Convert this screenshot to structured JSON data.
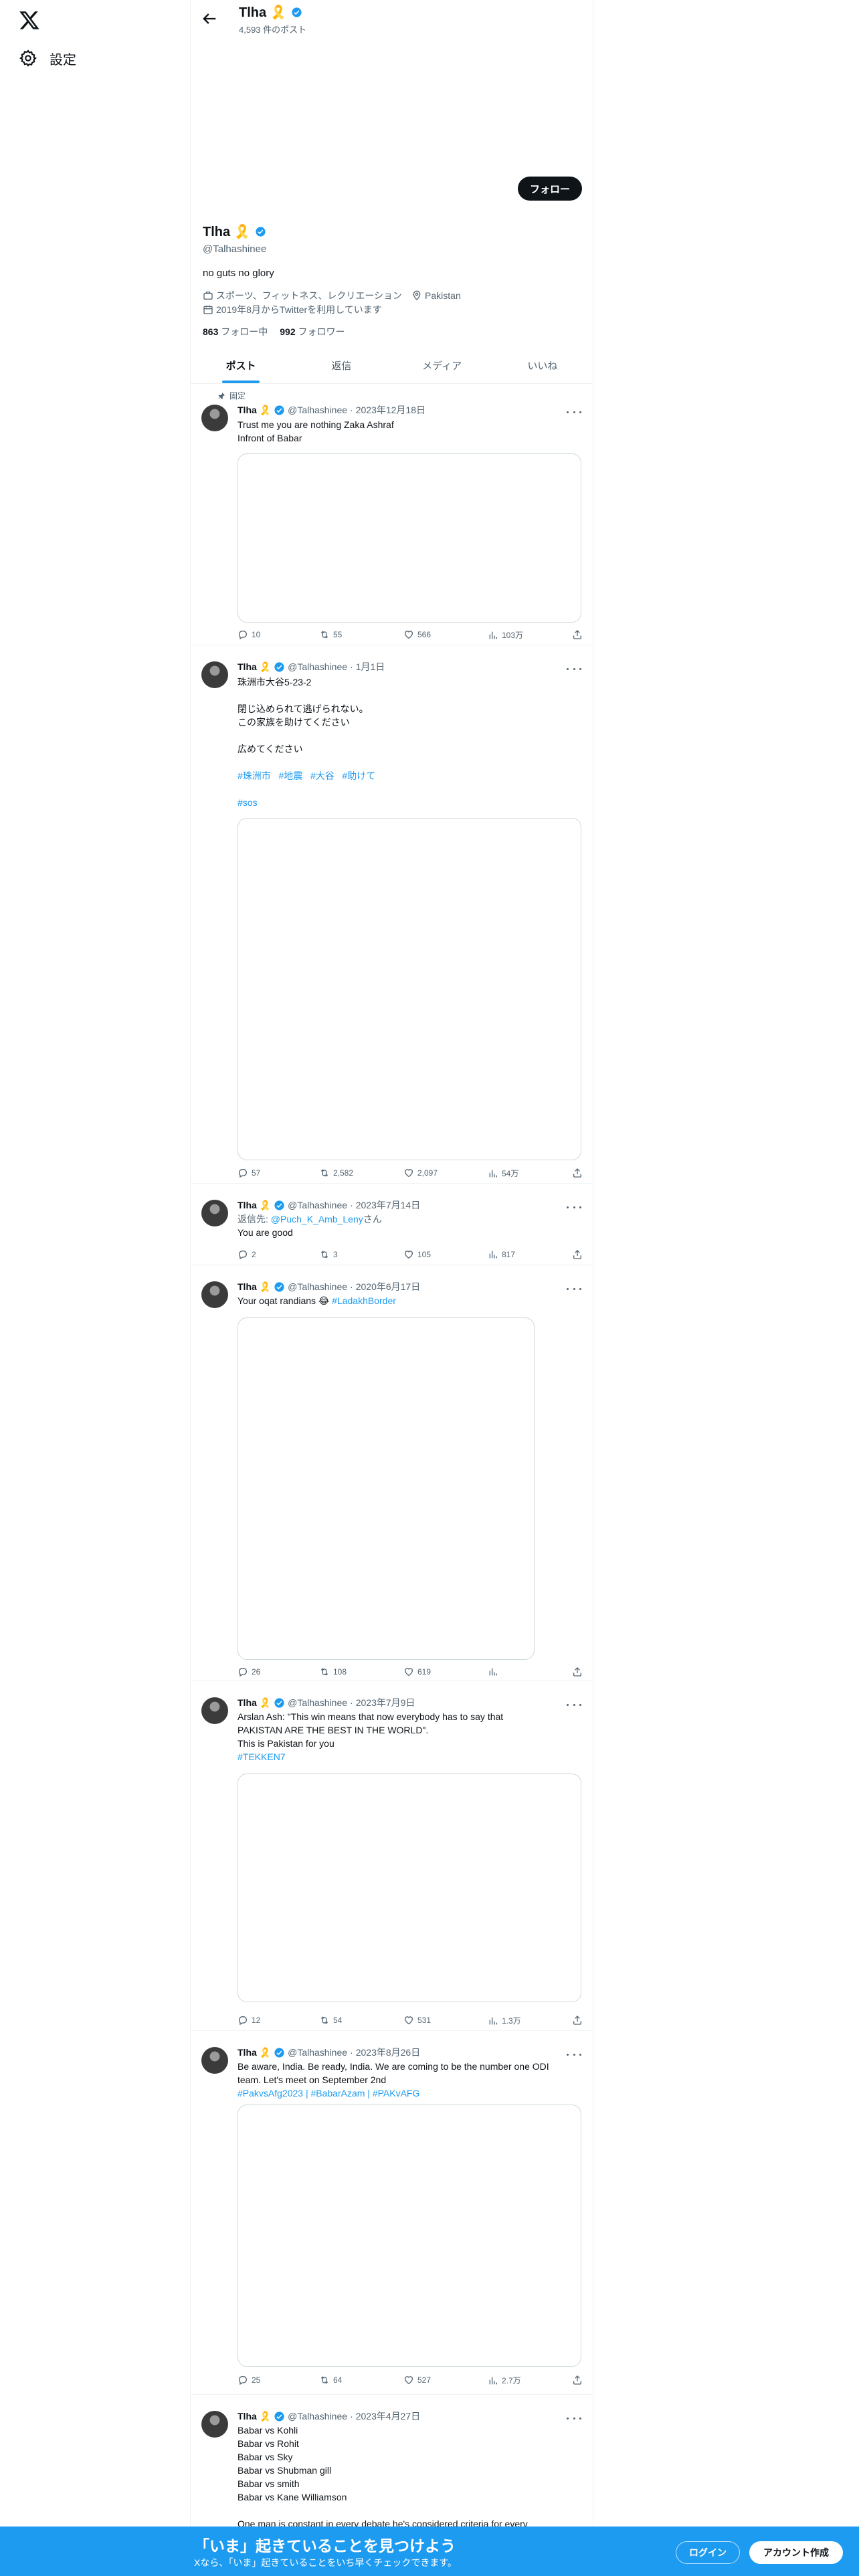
{
  "nav": {
    "settings_label": "設定"
  },
  "header": {
    "name": "Tlha 🎗️",
    "post_count": "4,593 件のポスト"
  },
  "profile": {
    "follow_label": "フォロー",
    "name": "Tlha 🎗️",
    "handle": "@Talhashinee",
    "bio": "no guts no glory",
    "category": "スポーツ、フィットネス、レクリエーション",
    "location": "Pakistan",
    "joined": "2019年8月からTwitterを利用しています",
    "following_count": "863",
    "following_label": "フォロー中",
    "followers_count": "992",
    "followers_label": "フォロワー"
  },
  "tabs": [
    {
      "label": "ポスト",
      "active": true
    },
    {
      "label": "返信"
    },
    {
      "label": "メディア"
    },
    {
      "label": "いいね"
    }
  ],
  "tweets": [
    {
      "pinned": "固定",
      "name": "Tlha 🎗️",
      "handle": "@Talhashinee",
      "date": "2023年12月18日",
      "lines": [
        "Trust me you are nothing Zaka Ashraf",
        "Infront of Babar"
      ],
      "replies": "10",
      "retweets": "55",
      "likes": "566",
      "views": "103万"
    },
    {
      "name": "Tlha 🎗️",
      "handle": "@Talhashinee",
      "date": "1月1日",
      "lines": [
        "珠洲市大谷5-23-2",
        "",
        "閉じ込められて逃げられない。",
        "この家族を助けてください",
        "",
        "広めてください"
      ],
      "hashtags": [
        "#珠洲市",
        "#地震",
        "#大谷",
        "#助けて"
      ],
      "hashtag2": "#sos",
      "replies": "57",
      "retweets": "2,582",
      "likes": "2,097",
      "views": "54万"
    },
    {
      "name": "Tlha 🎗️",
      "handle": "@Talhashinee",
      "date": "2023年7月14日",
      "reply_prefix": "返信先: ",
      "reply_to": "@Puch_K_Amb_Leny",
      "reply_suffix": "さん",
      "lines": [
        "You are good"
      ],
      "replies": "2",
      "retweets": "3",
      "likes": "105",
      "views": "817"
    },
    {
      "name": "Tlha 🎗️",
      "handle": "@Talhashinee",
      "date": "2020年6月17日",
      "text": "Your oqat randians 😂 ",
      "text_link": "#LadakhBorder",
      "replies": "26",
      "retweets": "108",
      "likes": "619",
      "views": ""
    },
    {
      "name": "Tlha 🎗️",
      "handle": "@Talhashinee",
      "date": "2023年7月9日",
      "lines": [
        "Arslan Ash: \"This win means that now everybody has to say that",
        "PAKISTAN ARE THE BEST IN THE WORLD\".",
        "This is Pakistan for you"
      ],
      "link": "#TEKKEN7",
      "replies": "12",
      "retweets": "54",
      "likes": "531",
      "views": "1.3万"
    },
    {
      "name": "Tlha 🎗️",
      "handle": "@Talhashinee",
      "date": "2023年8月26日",
      "lines": [
        "Be aware, India. Be ready, India. We are coming to be the number one ODI",
        "team. Let's meet on September 2nd"
      ],
      "link": "#PakvsAfg2023 | #BabarAzam | #PAKvAFG",
      "replies": "25",
      "retweets": "64",
      "likes": "527",
      "views": "2.7万"
    },
    {
      "name": "Tlha 🎗️",
      "handle": "@Talhashinee",
      "date": "2023年4月27日",
      "lines": [
        "Babar vs Kohli",
        "Babar vs Rohit",
        "Babar vs Sky",
        "Babar vs Shubman gill",
        "Babar vs smith",
        "Babar vs Kane  Williamson",
        "",
        "One man is constant in every debate he's considered criteria for every"
      ]
    }
  ],
  "banner": {
    "title": "「いま」起きていることを見つけよう",
    "subtitle": "Xなら、「いま」起きていることをいち早くチェックできます。",
    "login": "ログイン",
    "signup": "アカウント作成"
  }
}
